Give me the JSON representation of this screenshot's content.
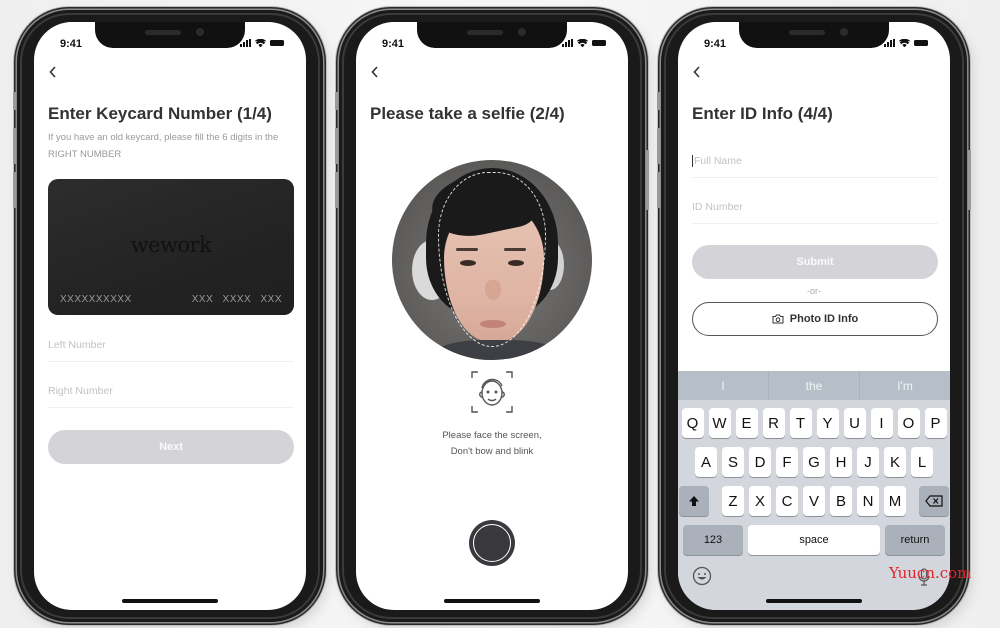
{
  "status_bar": {
    "time": "9:41"
  },
  "screens": {
    "keycard": {
      "title": "Enter Keycard Number (1/4)",
      "subtitle": "If you have an old keycard, please fill the 6 digits in the RIGHT NUMBER",
      "card": {
        "brand": "wework",
        "left_number": "XXXXXXXXXX",
        "right_number": "XXX XXXX XXX",
        "color": "#262626"
      },
      "left_field": {
        "placeholder": "Left Number",
        "value": ""
      },
      "right_field": {
        "placeholder": "Right Number",
        "value": ""
      },
      "next_label": "Next",
      "button_color": "#d4d4d8"
    },
    "selfie": {
      "title": "Please take a selfie (2/4)",
      "hint_line1": "Please face the screen,",
      "hint_line2": "Don't bow and blink",
      "icons": {
        "face_guide": "face-scan-icon",
        "shutter": "shutter-button"
      }
    },
    "id_info": {
      "title": "Enter ID Info (4/4)",
      "full_name": {
        "placeholder": "Full Name",
        "value": ""
      },
      "id_number": {
        "placeholder": "ID Number",
        "value": ""
      },
      "submit_label": "Submit",
      "or_label": "-or-",
      "photo_label": "Photo ID Info",
      "keyboard": {
        "suggestions": [
          "I",
          "the",
          "I'm"
        ],
        "row1": [
          "Q",
          "W",
          "E",
          "R",
          "T",
          "Y",
          "U",
          "I",
          "O",
          "P"
        ],
        "row2": [
          "A",
          "S",
          "D",
          "F",
          "G",
          "H",
          "J",
          "K",
          "L"
        ],
        "row3": [
          "Z",
          "X",
          "C",
          "V",
          "B",
          "N",
          "M"
        ],
        "numbers_label": "123",
        "space_label": "space",
        "return_label": "return"
      }
    }
  },
  "watermark": "Yuucn.com"
}
